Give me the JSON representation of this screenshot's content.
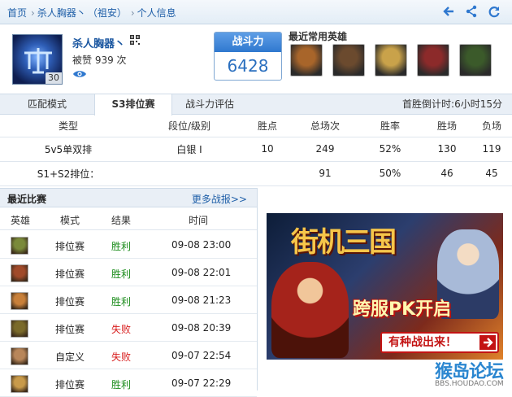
{
  "breadcrumb": {
    "home": "首页",
    "player": "杀人胸器丶",
    "server": "（祖安）",
    "page": "个人信息"
  },
  "profile": {
    "name": "杀人胸器丶",
    "likes": "被赞 939 次",
    "level": "30"
  },
  "power": {
    "label": "战斗力",
    "value": "6428"
  },
  "recent_heroes": {
    "label": "最近常用英雄",
    "colors": [
      "#a8652a",
      "#6b4a2e",
      "#c9a24a",
      "#8c2a2a",
      "#3b5a2a"
    ]
  },
  "tabs": [
    {
      "label": "匹配模式"
    },
    {
      "label": "S3排位赛"
    },
    {
      "label": "战斗力评估"
    }
  ],
  "countdown": "首胜倒计时:6小时15分",
  "rank_table": {
    "headers": [
      "类型",
      "段位/级别",
      "胜点",
      "总场次",
      "胜率",
      "胜场",
      "负场"
    ],
    "rows": [
      [
        "5v5单双排",
        "白银 I",
        "10",
        "249",
        "52%",
        "130",
        "119"
      ],
      [
        "S1+S2排位：",
        "",
        "",
        "91",
        "50%",
        "46",
        "45"
      ]
    ]
  },
  "recent_matches": {
    "title": "最近比赛",
    "more": "更多战报>>",
    "headers": [
      "英雄",
      "模式",
      "结果",
      "时间"
    ],
    "rows": [
      {
        "mode": "排位赛",
        "result": "胜利",
        "time": "09-08 23:00",
        "color": "#7a8a3a"
      },
      {
        "mode": "排位赛",
        "result": "胜利",
        "time": "09-08 22:01",
        "color": "#a04a2a"
      },
      {
        "mode": "排位赛",
        "result": "胜利",
        "time": "09-08 21:23",
        "color": "#c8803a"
      },
      {
        "mode": "排位赛",
        "result": "失败",
        "time": "09-08 20:39",
        "color": "#7a6a2a"
      },
      {
        "mode": "自定义",
        "result": "失败",
        "time": "09-07 22:54",
        "color": "#b8865a"
      },
      {
        "mode": "排位赛",
        "result": "胜利",
        "time": "09-07 22:29",
        "color": "#c89a4a"
      }
    ]
  },
  "ad": {
    "title": "街机三国",
    "subtitle": "跨服PK开启",
    "cta": "有种战出来！"
  },
  "watermark": {
    "text": "猴岛论坛",
    "url": "BBS.HOUDAO.COM"
  }
}
